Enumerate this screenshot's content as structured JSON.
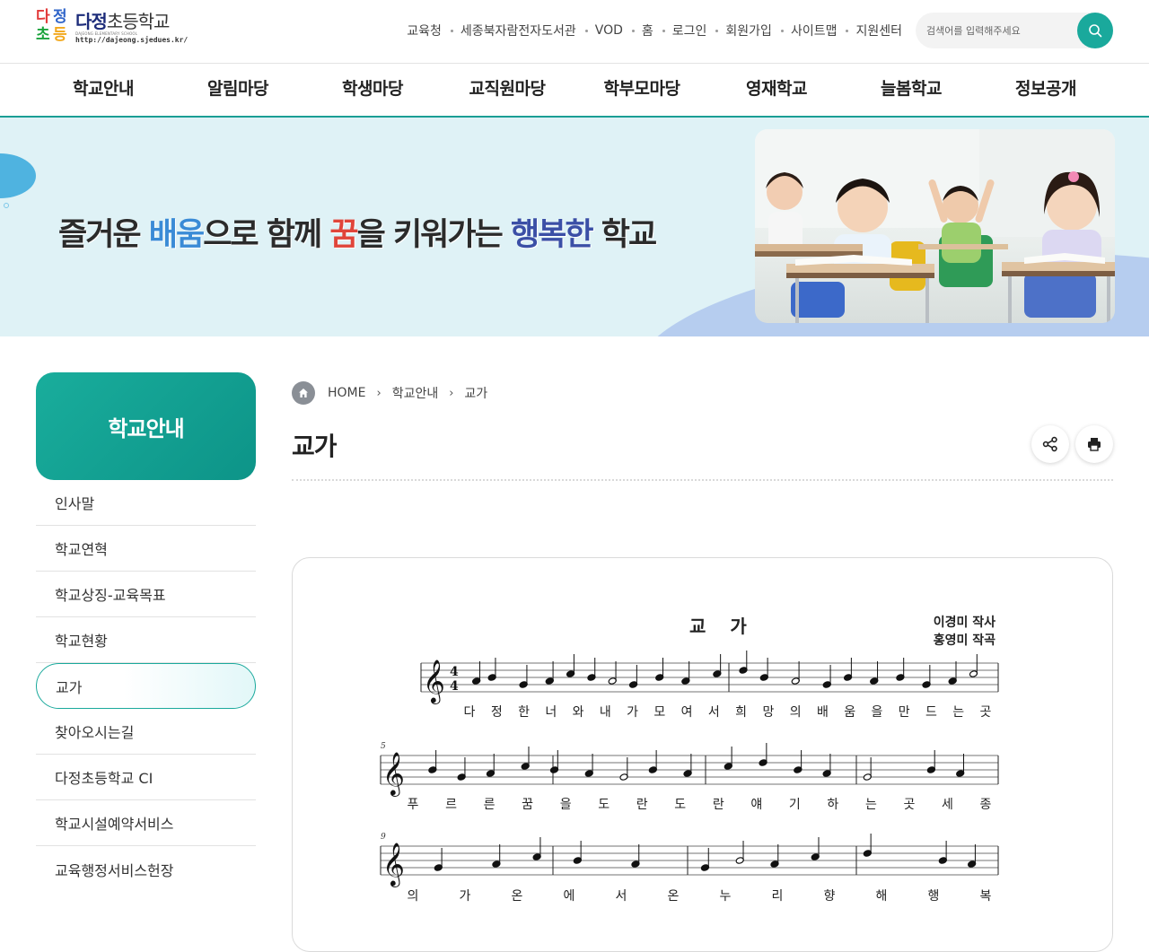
{
  "header": {
    "logo": {
      "mark": [
        "다",
        "정",
        "초",
        "등"
      ],
      "title_a": "다정",
      "title_b": "초등학교",
      "sub": "DAJEONG ELEMENTARY SCHOOL",
      "url": "http://dajeong.sjedues.kr/"
    },
    "util_links": [
      "교육청",
      "세종북자람전자도서관",
      "VOD",
      "홈",
      "로그인",
      "회원가입",
      "사이트맵",
      "지원센터"
    ],
    "search": {
      "placeholder": "검색어를 입력해주세요",
      "value": ""
    }
  },
  "gnb": [
    "학교안내",
    "알림마당",
    "학생마당",
    "교직원마당",
    "학부모마당",
    "영재학교",
    "늘봄학교",
    "정보공개"
  ],
  "hero": {
    "slogan": [
      {
        "text": "즐거운 ",
        "color": ""
      },
      {
        "text": "배움",
        "color": "blue"
      },
      {
        "text": "으로 함께 ",
        "color": ""
      },
      {
        "text": "꿈",
        "color": "red"
      },
      {
        "text": "을 키워가는 ",
        "color": ""
      },
      {
        "text": "행복한",
        "color": "navy"
      },
      {
        "text": " 학교",
        "color": ""
      }
    ]
  },
  "lnb": {
    "title": "학교안내",
    "items": [
      "인사말",
      "학교연혁",
      "학교상징-교육목표",
      "학교현황",
      "교가",
      "찾아오시는길",
      "다정초등학교 CI",
      "학교시설예약서비스",
      "교육행정서비스헌장"
    ],
    "active_index": 4
  },
  "content": {
    "breadcrumb": [
      "HOME",
      "학교안내",
      "교가"
    ],
    "title": "교가",
    "tools": {
      "share_icon": "share-icon",
      "print_icon": "print-icon"
    }
  },
  "score": {
    "title": "교 가",
    "credits": [
      "이경미 작사",
      "홍영미 작곡"
    ],
    "measure_numbers": [
      "5",
      "9"
    ],
    "time_signature": [
      "4",
      "4"
    ],
    "lyrics_line1": [
      "다",
      "정",
      "한",
      "너",
      "와",
      "내",
      "가",
      "모",
      "여",
      "서",
      "희",
      "망",
      "의",
      "배",
      "움",
      "을",
      "만",
      "드",
      "는",
      "곳"
    ],
    "lyrics_line2": [
      "푸",
      "르",
      "른",
      "꿈",
      "을",
      "도",
      "란",
      "도",
      "란",
      "얘",
      "기",
      "하",
      "는",
      "곳",
      "세",
      "종"
    ],
    "lyrics_line3": [
      "의",
      "가",
      "온",
      "에",
      "서",
      "온",
      "누",
      "리",
      "향",
      "해",
      "행",
      "복"
    ]
  },
  "colors": {
    "brand": "#1aa99c",
    "gnb_border": "#1a9e95",
    "hero_bg": "#dff2f6",
    "lnb_head": "#19ad9c"
  }
}
